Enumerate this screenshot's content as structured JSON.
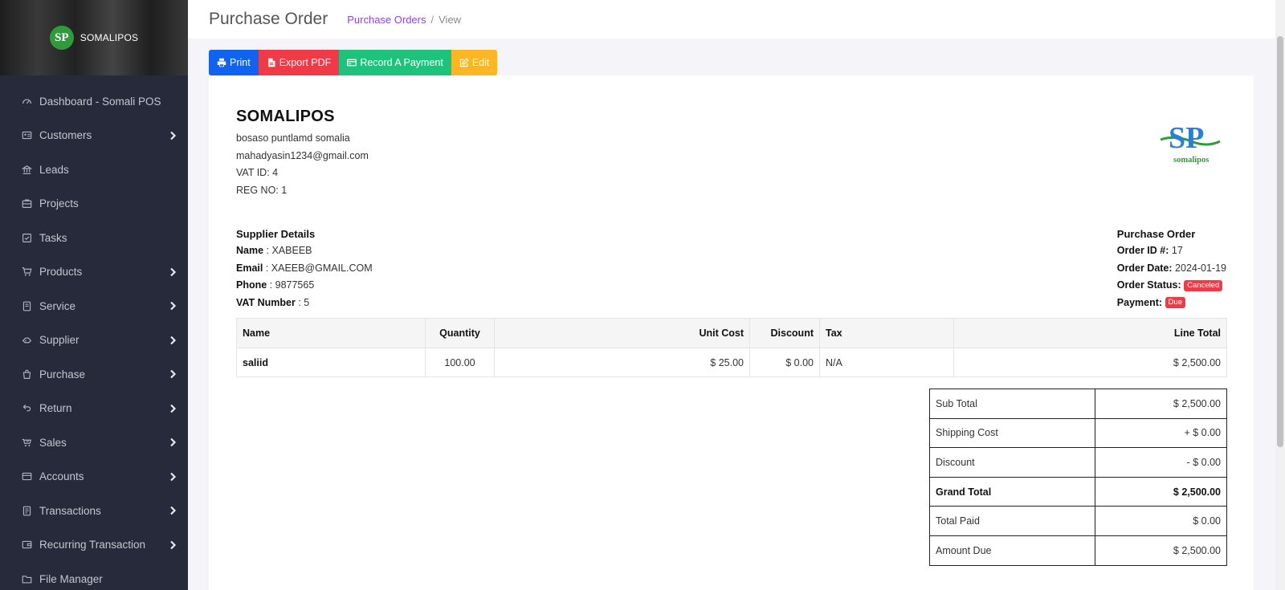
{
  "brand": {
    "logo_text": "SP",
    "name": "SOMALIPOS"
  },
  "sidebar": {
    "items": [
      {
        "label": "Dashboard - Somali POS",
        "icon": "dashboard-icon",
        "expandable": false
      },
      {
        "label": "Customers",
        "icon": "customers-icon",
        "expandable": true
      },
      {
        "label": "Leads",
        "icon": "leads-icon",
        "expandable": false
      },
      {
        "label": "Projects",
        "icon": "projects-icon",
        "expandable": false
      },
      {
        "label": "Tasks",
        "icon": "tasks-icon",
        "expandable": false
      },
      {
        "label": "Products",
        "icon": "cart-icon",
        "expandable": true
      },
      {
        "label": "Service",
        "icon": "service-icon",
        "expandable": true
      },
      {
        "label": "Supplier",
        "icon": "supplier-icon",
        "expandable": true
      },
      {
        "label": "Purchase",
        "icon": "purchase-icon",
        "expandable": true
      },
      {
        "label": "Return",
        "icon": "return-icon",
        "expandable": true
      },
      {
        "label": "Sales",
        "icon": "sales-icon",
        "expandable": true
      },
      {
        "label": "Accounts",
        "icon": "accounts-icon",
        "expandable": true
      },
      {
        "label": "Transactions",
        "icon": "transactions-icon",
        "expandable": true
      },
      {
        "label": "Recurring Transaction",
        "icon": "recurring-icon",
        "expandable": true
      },
      {
        "label": "File Manager",
        "icon": "folder-icon",
        "expandable": false
      }
    ]
  },
  "header": {
    "title": "Purchase Order",
    "breadcrumb": {
      "link": "Purchase Orders",
      "separator": "/",
      "current": "View"
    }
  },
  "toolbar": {
    "print": "Print",
    "export_pdf": "Export PDF",
    "record_payment": "Record A Payment",
    "edit": "Edit"
  },
  "company": {
    "name": "SOMALIPOS",
    "address": "bosaso puntlamd somalia",
    "email": "mahadyasin1234@gmail.com",
    "vat": "VAT ID: 4",
    "reg": "REG NO: 1",
    "logo_text": "SP",
    "logo_subtitle": "somalipos"
  },
  "supplier": {
    "title": "Supplier Details",
    "name_label": "Name",
    "name": "XABEEB",
    "email_label": "Email",
    "email": "XAEEB@GMAIL.COM",
    "phone_label": "Phone",
    "phone": "9877565",
    "vat_label": "VAT Number",
    "vat": "5"
  },
  "order": {
    "title": "Purchase Order",
    "id_label": "Order ID #:",
    "id": "17",
    "date_label": "Order Date:",
    "date": "2024-01-19",
    "status_label": "Order Status:",
    "status": "Canceled",
    "payment_label": "Payment:",
    "payment": "Due"
  },
  "items_table": {
    "headers": [
      "Name",
      "Quantity",
      "Unit Cost",
      "Discount",
      "Tax",
      "Line Total"
    ],
    "rows": [
      {
        "name": "saliid",
        "quantity": "100.00",
        "unit_cost": "$ 25.00",
        "discount": "$ 0.00",
        "tax": "N/A",
        "line_total": "$ 2,500.00"
      }
    ]
  },
  "totals": {
    "sub_total_label": "Sub Total",
    "sub_total": "$ 2,500.00",
    "shipping_label": "Shipping Cost",
    "shipping": "+ $ 0.00",
    "discount_label": "Discount",
    "discount": "- $ 0.00",
    "grand_total_label": "Grand Total",
    "grand_total": "$ 2,500.00",
    "total_paid_label": "Total Paid",
    "total_paid": "$ 0.00",
    "amount_due_label": "Amount Due",
    "amount_due": "$ 2,500.00"
  },
  "colors": {
    "sidebar_bg": "#262a3b",
    "print": "#1262f0",
    "export_pdf": "#ee3b47",
    "record_payment": "#1fc27a",
    "edit": "#fbb625",
    "badge_danger": "#ee3b47",
    "breadcrumb_link": "#8a3ffc"
  }
}
